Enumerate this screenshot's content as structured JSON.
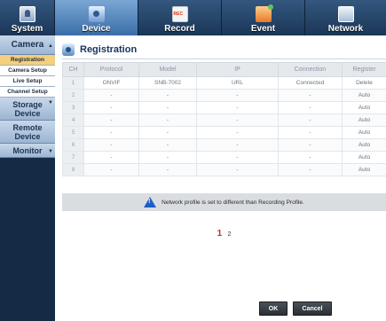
{
  "top_tabs": [
    {
      "label": "System",
      "icon": "system-icon"
    },
    {
      "label": "Device",
      "icon": "device-icon"
    },
    {
      "label": "Record",
      "icon": "record-icon"
    },
    {
      "label": "Event",
      "icon": "event-icon"
    },
    {
      "label": "Network",
      "icon": "network-icon"
    }
  ],
  "sidebar": {
    "camera": "Camera",
    "camera_items": [
      "Registration",
      "Camera Setup",
      "Live Setup",
      "Channel Setup"
    ],
    "storage": [
      "Storage",
      "Device"
    ],
    "remote": [
      "Remote",
      "Device"
    ],
    "monitor": "Monitor"
  },
  "page_title": "Registration",
  "table": {
    "headers": [
      "CH",
      "Protocol",
      "Model",
      "IP",
      "Connection",
      "Register"
    ],
    "rows": [
      [
        "1",
        "ONVIF",
        "SNB-7002",
        "URL",
        "Connected",
        "Delete"
      ],
      [
        "2",
        "-",
        "-",
        "-",
        "-",
        "Auto"
      ],
      [
        "3",
        "-",
        "-",
        "-",
        "-",
        "Auto"
      ],
      [
        "4",
        "-",
        "-",
        "-",
        "-",
        "Auto"
      ],
      [
        "5",
        "-",
        "-",
        "-",
        "-",
        "Auto"
      ],
      [
        "6",
        "-",
        "-",
        "-",
        "-",
        "Auto"
      ],
      [
        "7",
        "-",
        "-",
        "-",
        "-",
        "Auto"
      ],
      [
        "8",
        "-",
        "-",
        "-",
        "-",
        "Auto"
      ]
    ]
  },
  "notice": "Network profile is set to different than Recording Profile.",
  "pager": {
    "current": "1",
    "next": "2"
  },
  "buttons": {
    "ok": "OK",
    "cancel": "Cancel"
  }
}
